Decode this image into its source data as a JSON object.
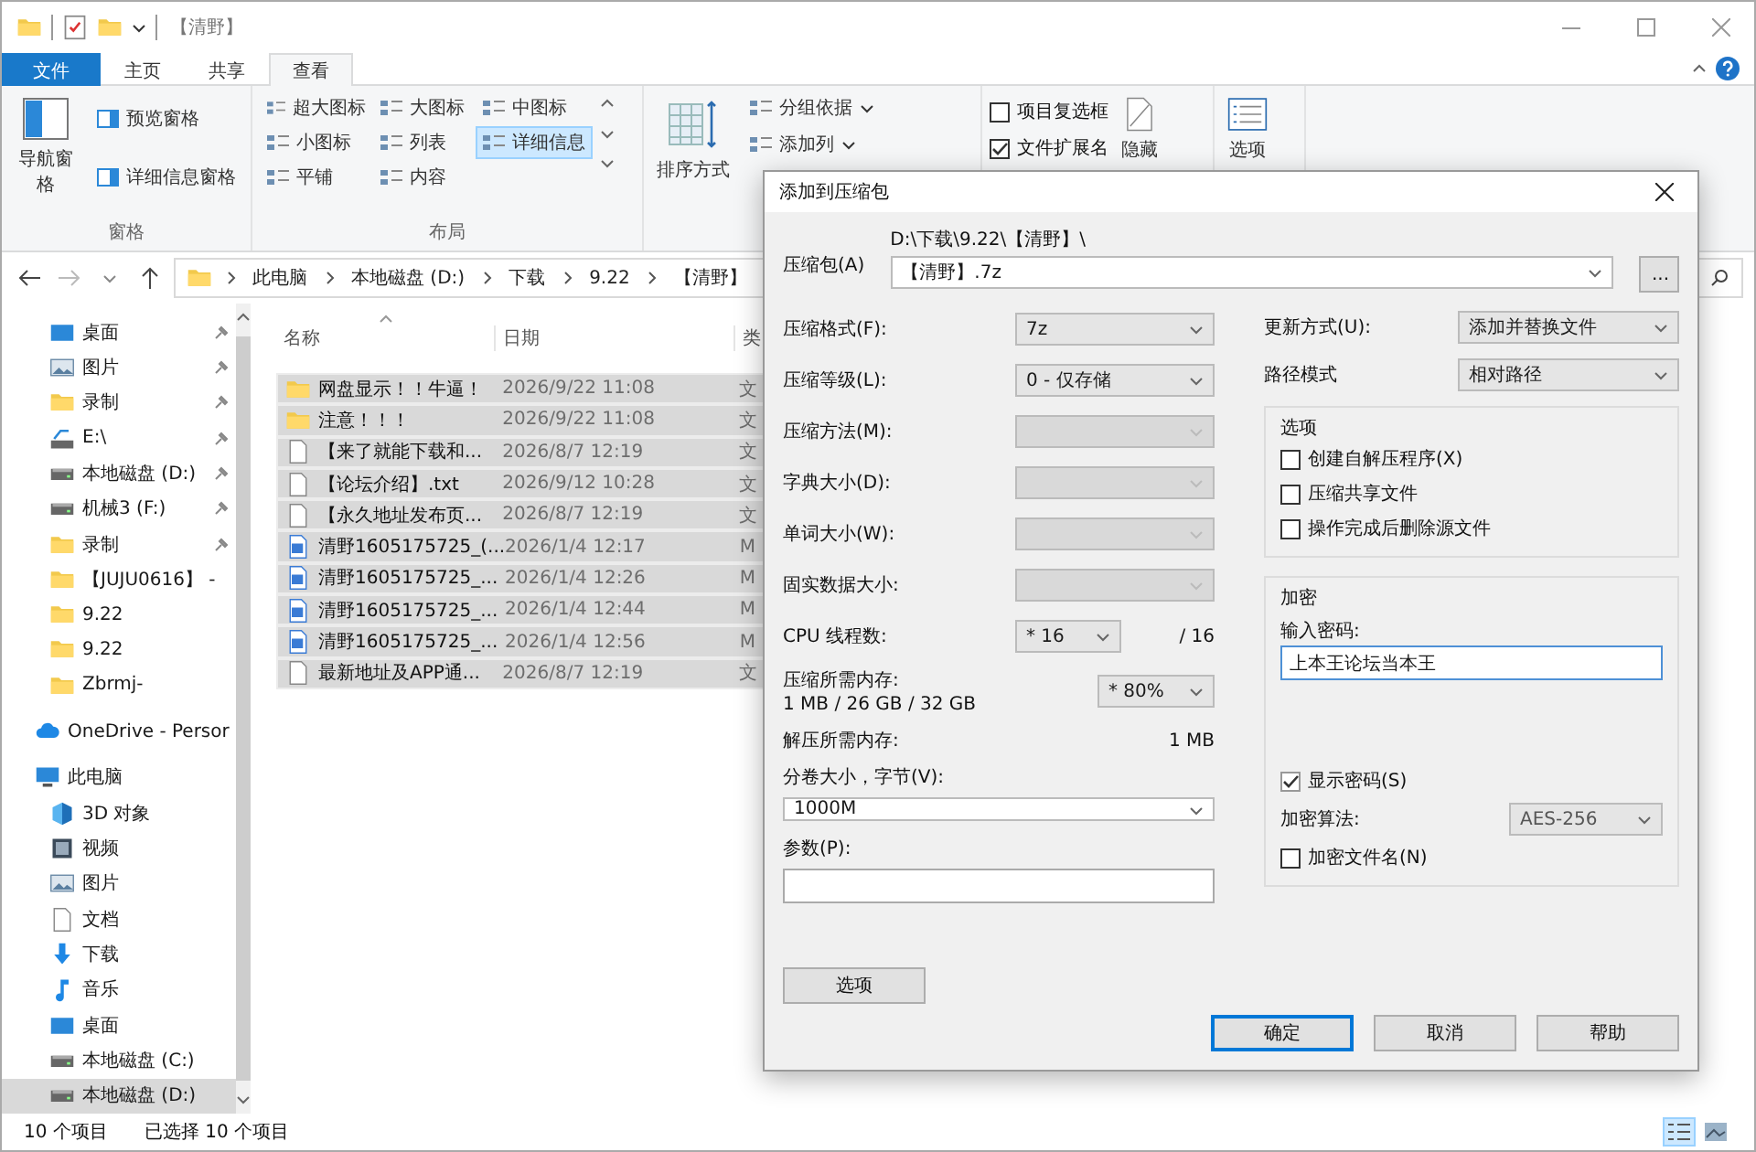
{
  "window": {
    "title": "【清野】"
  },
  "ribbon": {
    "tabs": [
      {
        "label": "文件",
        "kind": "file",
        "selected": false
      },
      {
        "label": "主页",
        "kind": "tab",
        "selected": false
      },
      {
        "label": "共享",
        "kind": "tab",
        "selected": false
      },
      {
        "label": "查看",
        "kind": "tab",
        "selected": true
      }
    ],
    "panes": {
      "label": "窗格",
      "nav_pane": "导航窗格",
      "buttons": [
        "预览窗格",
        "详细信息窗格"
      ]
    },
    "layout": {
      "label": "布局",
      "options": [
        {
          "label": "超大图标",
          "selected": false
        },
        {
          "label": "大图标",
          "selected": false
        },
        {
          "label": "中图标",
          "selected": false
        },
        {
          "label": "小图标",
          "selected": false
        },
        {
          "label": "列表",
          "selected": false
        },
        {
          "label": "详细信息",
          "selected": true
        },
        {
          "label": "平铺",
          "selected": false
        },
        {
          "label": "内容",
          "selected": false
        }
      ]
    },
    "current_view": {
      "sort": "排序方式",
      "items": [
        "分组依据",
        "添加列"
      ]
    },
    "show_hide": {
      "checks": [
        {
          "label": "项目复选框",
          "checked": false
        },
        {
          "label": "文件扩展名",
          "checked": true
        }
      ],
      "hide": "隐藏"
    },
    "options": "选项"
  },
  "address": {
    "crumbs": [
      "此电脑",
      "本地磁盘 (D:)",
      "下载",
      "9.22",
      "【清野】"
    ]
  },
  "sidebar": {
    "quick_access": [
      {
        "label": "桌面",
        "kind": "desktop",
        "pinned": true,
        "selected": false
      },
      {
        "label": "图片",
        "kind": "pictures",
        "pinned": true,
        "selected": false
      },
      {
        "label": "录制",
        "kind": "folder",
        "pinned": true,
        "selected": false
      },
      {
        "label": "E:\\",
        "kind": "netdrive",
        "pinned": true,
        "selected": false
      },
      {
        "label": "本地磁盘 (D:)",
        "kind": "drive",
        "pinned": true,
        "selected": false
      },
      {
        "label": "机械3 (F:)",
        "kind": "drive",
        "pinned": true,
        "selected": false
      },
      {
        "label": "录制",
        "kind": "folder",
        "pinned": true,
        "selected": false
      },
      {
        "label": "【JUJU0616】 -",
        "kind": "folder",
        "pinned": false,
        "selected": false
      },
      {
        "label": "9.22",
        "kind": "folder",
        "pinned": false,
        "selected": false
      },
      {
        "label": "9.22",
        "kind": "folder",
        "pinned": false,
        "selected": false
      },
      {
        "label": "Zbrmj-",
        "kind": "folder",
        "pinned": false,
        "selected": false
      }
    ],
    "onedrive": {
      "label": "OneDrive - Persor",
      "kind": "cloud"
    },
    "this_pc": {
      "label": "此电脑",
      "kind": "pc",
      "children": [
        {
          "label": "3D 对象",
          "kind": "cube",
          "selected": false
        },
        {
          "label": "视频",
          "kind": "video",
          "selected": false
        },
        {
          "label": "图片",
          "kind": "pictures",
          "selected": false
        },
        {
          "label": "文档",
          "kind": "doc",
          "selected": false
        },
        {
          "label": "下载",
          "kind": "download",
          "selected": false
        },
        {
          "label": "音乐",
          "kind": "music",
          "selected": false
        },
        {
          "label": "桌面",
          "kind": "desktop",
          "selected": false
        },
        {
          "label": "本地磁盘 (C:)",
          "kind": "drive",
          "selected": false
        },
        {
          "label": "本地磁盘 (D:)",
          "kind": "drive",
          "selected": true
        }
      ]
    }
  },
  "file_list": {
    "columns": [
      "名称",
      "日期",
      "类"
    ],
    "rows": [
      {
        "name": "网盘显示！！牛逼！",
        "date": "2026/9/22 11:08",
        "column_3": "文",
        "kind": "folder",
        "selected": true
      },
      {
        "name": "注意！！！",
        "date": "2026/9/22 11:08",
        "column_3": "文",
        "kind": "folder",
        "selected": true
      },
      {
        "name": "【来了就能下载和...",
        "date": "2026/8/7 12:19",
        "column_3": "文",
        "kind": "txt",
        "selected": true
      },
      {
        "name": "【论坛介绍】.txt",
        "date": "2026/9/12 10:28",
        "column_3": "文",
        "kind": "txt",
        "selected": true
      },
      {
        "name": "【永久地址发布页...",
        "date": "2026/8/7 12:19",
        "column_3": "文",
        "kind": "txt",
        "selected": true
      },
      {
        "name": "清野1605175725_(...",
        "date": "2026/1/4 12:17",
        "column_3": "M",
        "kind": "media",
        "selected": true
      },
      {
        "name": "清野1605175725_...",
        "date": "2026/1/4 12:26",
        "column_3": "M",
        "kind": "media",
        "selected": true
      },
      {
        "name": "清野1605175725_...",
        "date": "2026/1/4 12:44",
        "column_3": "M",
        "kind": "media",
        "selected": true
      },
      {
        "name": "清野1605175725_...",
        "date": "2026/1/4 12:56",
        "column_3": "M",
        "kind": "media",
        "selected": true
      },
      {
        "name": "最新地址及APP通...",
        "date": "2026/8/7 12:19",
        "column_3": "文",
        "kind": "txt",
        "selected": true
      }
    ]
  },
  "status_bar": {
    "count": "10 个项目",
    "selection": "已选择 10 个项目",
    "views": [
      {
        "kind": "details",
        "selected": true
      },
      {
        "kind": "tiles",
        "selected": false
      }
    ]
  },
  "dialog": {
    "title": "添加到压缩包",
    "archive_label": "压缩包(A)",
    "archive_path": "D:\\下载\\9.22\\【清野】\\",
    "archive_name": "【清野】.7z",
    "browse": "...",
    "left_fields": [
      {
        "label": "压缩格式(F):",
        "value": "7z",
        "disabled": false
      },
      {
        "label": "压缩等级(L):",
        "value": "0 - 仅存储",
        "disabled": false
      },
      {
        "label": "压缩方法(M):",
        "disabled": true
      },
      {
        "label": "字典大小(D):",
        "disabled": true
      },
      {
        "label": "单词大小(W):",
        "disabled": true
      },
      {
        "label": "固实数据大小:",
        "disabled": true
      }
    ],
    "cpu": {
      "label": "CPU 线程数:",
      "value": "* 16",
      "total": "/ 16"
    },
    "memory": {
      "label": "压缩所需内存:",
      "detail": "1 MB / 26 GB / 32 GB",
      "value": "* 80%"
    },
    "decompress_memory": {
      "label": "解压所需内存:",
      "value": "1 MB"
    },
    "split": {
      "label": "分卷大小，字节(V):",
      "value": "1000M"
    },
    "params": {
      "label": "参数(P):"
    },
    "options_button": "选项",
    "right_fields": [
      {
        "label": "更新方式(U):",
        "value": "添加并替换文件"
      },
      {
        "label": "路径模式",
        "value": "相对路径"
      }
    ],
    "options_group": {
      "title": "选项",
      "checks": [
        {
          "label": "创建自解压程序(X)",
          "checked": false
        },
        {
          "label": "压缩共享文件",
          "checked": false
        },
        {
          "label": "操作完成后删除源文件",
          "checked": false
        }
      ]
    },
    "encryption": {
      "title": "加密",
      "password_label": "输入密码:",
      "password": "上本王论坛当本王",
      "show_password": {
        "label": "显示密码(S)",
        "checked": true
      },
      "method_label": "加密算法:",
      "method": "AES-256",
      "encrypt_names": {
        "label": "加密文件名(N)",
        "checked": false
      }
    },
    "buttons": [
      {
        "label": "确定",
        "default": true
      },
      {
        "label": "取消",
        "default": false
      },
      {
        "label": "帮助",
        "default": false
      }
    ]
  }
}
